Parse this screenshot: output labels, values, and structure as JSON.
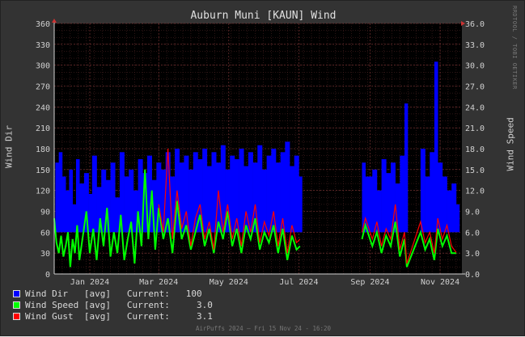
{
  "chart_data": {
    "type": "line",
    "title": "Auburn Muni [KAUN] Wind",
    "ylabel_left": "Wind Dir",
    "ylabel_right": "Wind Speed",
    "y_left_lim": [
      0,
      360
    ],
    "y_left_ticks": [
      "0",
      "30",
      "60",
      "90",
      "120",
      "150",
      "180",
      "210",
      "240",
      "270",
      "300",
      "330",
      "360"
    ],
    "y_right_lim": [
      0,
      36
    ],
    "y_right_ticks": [
      "0.0",
      "3.0",
      "6.0",
      "9.0",
      "12.0",
      "15.0",
      "18.0",
      "21.0",
      "24.0",
      "27.0",
      "30.0",
      "33.0",
      "36.0"
    ],
    "x_range": [
      "2023-12-01",
      "2024-11-20"
    ],
    "x_ticks": [
      {
        "label": "Jan 2024",
        "date": "2024-01-01"
      },
      {
        "label": "Mar 2024",
        "date": "2024-03-01"
      },
      {
        "label": "May 2024",
        "date": "2024-05-01"
      },
      {
        "label": "Jul 2024",
        "date": "2024-07-01"
      },
      {
        "label": "Sep 2024",
        "date": "2024-09-01"
      },
      {
        "label": "Nov 2024",
        "date": "2024-11-01"
      }
    ],
    "grid": true,
    "legend_position": "bottom-left",
    "series": [
      {
        "name": "Wind Dir",
        "stat": "[avg]",
        "current_label": "Current:",
        "current": "100",
        "color": "#0000ff",
        "axis": "left",
        "style": "bar",
        "points": [
          [
            "2023-12-02",
            160
          ],
          [
            "2023-12-05",
            175
          ],
          [
            "2023-12-08",
            140
          ],
          [
            "2023-12-11",
            120
          ],
          [
            "2023-12-14",
            150
          ],
          [
            "2023-12-17",
            100
          ],
          [
            "2023-12-20",
            165
          ],
          [
            "2023-12-23",
            130
          ],
          [
            "2023-12-27",
            145
          ],
          [
            "2023-12-31",
            115
          ],
          [
            "2024-01-03",
            170
          ],
          [
            "2024-01-07",
            125
          ],
          [
            "2024-01-11",
            150
          ],
          [
            "2024-01-15",
            135
          ],
          [
            "2024-01-19",
            160
          ],
          [
            "2024-01-23",
            110
          ],
          [
            "2024-01-27",
            175
          ],
          [
            "2024-01-31",
            140
          ],
          [
            "2024-02-04",
            150
          ],
          [
            "2024-02-08",
            120
          ],
          [
            "2024-02-12",
            165
          ],
          [
            "2024-02-16",
            145
          ],
          [
            "2024-02-20",
            170
          ],
          [
            "2024-02-24",
            135
          ],
          [
            "2024-02-28",
            160
          ],
          [
            "2024-03-03",
            150
          ],
          [
            "2024-03-07",
            175
          ],
          [
            "2024-03-11",
            140
          ],
          [
            "2024-03-15",
            180
          ],
          [
            "2024-03-19",
            160
          ],
          [
            "2024-03-23",
            170
          ],
          [
            "2024-03-27",
            150
          ],
          [
            "2024-03-31",
            175
          ],
          [
            "2024-04-04",
            165
          ],
          [
            "2024-04-08",
            180
          ],
          [
            "2024-04-12",
            155
          ],
          [
            "2024-04-16",
            175
          ],
          [
            "2024-04-20",
            160
          ],
          [
            "2024-04-24",
            185
          ],
          [
            "2024-04-28",
            150
          ],
          [
            "2024-05-02",
            170
          ],
          [
            "2024-05-06",
            165
          ],
          [
            "2024-05-10",
            180
          ],
          [
            "2024-05-14",
            155
          ],
          [
            "2024-05-18",
            175
          ],
          [
            "2024-05-22",
            160
          ],
          [
            "2024-05-26",
            185
          ],
          [
            "2024-05-30",
            150
          ],
          [
            "2024-06-03",
            170
          ],
          [
            "2024-06-07",
            180
          ],
          [
            "2024-06-11",
            160
          ],
          [
            "2024-06-15",
            175
          ],
          [
            "2024-06-19",
            190
          ],
          [
            "2024-06-23",
            155
          ],
          [
            "2024-06-27",
            170
          ],
          [
            "2024-07-01",
            140
          ],
          [
            "2024-08-25",
            160
          ],
          [
            "2024-08-28",
            140
          ],
          [
            "2024-09-03",
            150
          ],
          [
            "2024-09-07",
            120
          ],
          [
            "2024-09-11",
            165
          ],
          [
            "2024-09-15",
            145
          ],
          [
            "2024-09-19",
            160
          ],
          [
            "2024-09-23",
            130
          ],
          [
            "2024-09-27",
            170
          ],
          [
            "2024-10-01",
            245
          ],
          [
            "2024-10-15",
            180
          ],
          [
            "2024-10-19",
            140
          ],
          [
            "2024-10-23",
            175
          ],
          [
            "2024-10-27",
            305
          ],
          [
            "2024-10-30",
            160
          ],
          [
            "2024-11-03",
            140
          ],
          [
            "2024-11-07",
            120
          ],
          [
            "2024-11-11",
            130
          ],
          [
            "2024-11-15",
            100
          ]
        ]
      },
      {
        "name": "Wind Speed",
        "stat": "[avg]",
        "current_label": "Current:",
        "current": "3.0",
        "color": "#00ff00",
        "axis": "right",
        "style": "line",
        "points": [
          [
            "2023-12-01",
            8.0
          ],
          [
            "2023-12-03",
            4.5
          ],
          [
            "2023-12-05",
            3.0
          ],
          [
            "2023-12-07",
            5.5
          ],
          [
            "2023-12-09",
            2.5
          ],
          [
            "2023-12-11",
            4.0
          ],
          [
            "2023-12-13",
            6.0
          ],
          [
            "2023-12-15",
            1.0
          ],
          [
            "2023-12-17",
            5.0
          ],
          [
            "2023-12-19",
            3.0
          ],
          [
            "2023-12-21",
            7.0
          ],
          [
            "2023-12-23",
            2.0
          ],
          [
            "2023-12-26",
            5.5
          ],
          [
            "2023-12-29",
            9.0
          ],
          [
            "2024-01-01",
            3.0
          ],
          [
            "2024-01-04",
            6.5
          ],
          [
            "2024-01-07",
            2.0
          ],
          [
            "2024-01-10",
            8.0
          ],
          [
            "2024-01-13",
            4.0
          ],
          [
            "2024-01-16",
            9.5
          ],
          [
            "2024-01-19",
            2.5
          ],
          [
            "2024-01-22",
            6.0
          ],
          [
            "2024-01-25",
            3.0
          ],
          [
            "2024-01-28",
            8.5
          ],
          [
            "2024-01-31",
            2.0
          ],
          [
            "2024-02-03",
            5.0
          ],
          [
            "2024-02-06",
            7.5
          ],
          [
            "2024-02-09",
            1.5
          ],
          [
            "2024-02-12",
            9.0
          ],
          [
            "2024-02-15",
            4.0
          ],
          [
            "2024-02-18",
            15.0
          ],
          [
            "2024-02-21",
            5.0
          ],
          [
            "2024-02-24",
            12.0
          ],
          [
            "2024-02-27",
            3.5
          ],
          [
            "2024-03-01",
            9.5
          ],
          [
            "2024-03-05",
            5.0
          ],
          [
            "2024-03-09",
            8.0
          ],
          [
            "2024-03-13",
            3.0
          ],
          [
            "2024-03-17",
            10.5
          ],
          [
            "2024-03-21",
            5.0
          ],
          [
            "2024-03-25",
            7.0
          ],
          [
            "2024-03-29",
            3.5
          ],
          [
            "2024-04-02",
            6.0
          ],
          [
            "2024-04-06",
            8.5
          ],
          [
            "2024-04-10",
            4.0
          ],
          [
            "2024-04-14",
            6.5
          ],
          [
            "2024-04-18",
            3.0
          ],
          [
            "2024-04-22",
            7.5
          ],
          [
            "2024-04-26",
            5.0
          ],
          [
            "2024-04-30",
            9.0
          ],
          [
            "2024-05-04",
            4.0
          ],
          [
            "2024-05-08",
            6.5
          ],
          [
            "2024-05-12",
            3.0
          ],
          [
            "2024-05-16",
            7.0
          ],
          [
            "2024-05-20",
            5.0
          ],
          [
            "2024-05-24",
            8.0
          ],
          [
            "2024-05-28",
            3.5
          ],
          [
            "2024-06-01",
            6.0
          ],
          [
            "2024-06-05",
            4.5
          ],
          [
            "2024-06-09",
            7.0
          ],
          [
            "2024-06-13",
            3.0
          ],
          [
            "2024-06-17",
            6.5
          ],
          [
            "2024-06-21",
            2.0
          ],
          [
            "2024-06-25",
            5.5
          ],
          [
            "2024-06-29",
            3.5
          ],
          [
            "2024-07-02",
            4.0
          ],
          [
            "2024-08-25",
            5.0
          ],
          [
            "2024-08-28",
            7.0
          ],
          [
            "2024-09-03",
            4.0
          ],
          [
            "2024-09-07",
            6.0
          ],
          [
            "2024-09-11",
            3.0
          ],
          [
            "2024-09-15",
            5.5
          ],
          [
            "2024-09-19",
            4.0
          ],
          [
            "2024-09-23",
            7.5
          ],
          [
            "2024-09-27",
            2.5
          ],
          [
            "2024-10-01",
            5.0
          ],
          [
            "2024-10-03",
            1.0
          ],
          [
            "2024-10-15",
            6.0
          ],
          [
            "2024-10-19",
            3.5
          ],
          [
            "2024-10-23",
            5.0
          ],
          [
            "2024-10-27",
            2.0
          ],
          [
            "2024-10-30",
            6.5
          ],
          [
            "2024-11-03",
            4.0
          ],
          [
            "2024-11-07",
            5.5
          ],
          [
            "2024-11-11",
            3.0
          ],
          [
            "2024-11-15",
            3.0
          ]
        ]
      },
      {
        "name": "Wind Gust",
        "stat": "[avg]",
        "current_label": "Current:",
        "current": "3.1",
        "color": "#ff0000",
        "axis": "right",
        "style": "line",
        "points": [
          [
            "2024-03-01",
            10.0
          ],
          [
            "2024-03-05",
            6.0
          ],
          [
            "2024-03-09",
            18.0
          ],
          [
            "2024-03-13",
            5.0
          ],
          [
            "2024-03-17",
            12.0
          ],
          [
            "2024-03-21",
            6.5
          ],
          [
            "2024-03-25",
            9.0
          ],
          [
            "2024-03-29",
            4.0
          ],
          [
            "2024-04-02",
            8.0
          ],
          [
            "2024-04-06",
            10.0
          ],
          [
            "2024-04-10",
            5.0
          ],
          [
            "2024-04-14",
            7.5
          ],
          [
            "2024-04-18",
            3.5
          ],
          [
            "2024-04-22",
            12.0
          ],
          [
            "2024-04-26",
            6.0
          ],
          [
            "2024-04-30",
            10.0
          ],
          [
            "2024-05-04",
            5.0
          ],
          [
            "2024-05-08",
            8.0
          ],
          [
            "2024-05-12",
            4.0
          ],
          [
            "2024-05-16",
            9.0
          ],
          [
            "2024-05-20",
            6.0
          ],
          [
            "2024-05-24",
            10.0
          ],
          [
            "2024-05-28",
            4.5
          ],
          [
            "2024-06-01",
            7.5
          ],
          [
            "2024-06-05",
            5.5
          ],
          [
            "2024-06-09",
            9.0
          ],
          [
            "2024-06-13",
            4.0
          ],
          [
            "2024-06-17",
            8.0
          ],
          [
            "2024-06-21",
            3.0
          ],
          [
            "2024-06-25",
            7.0
          ],
          [
            "2024-06-29",
            4.5
          ],
          [
            "2024-07-02",
            5.0
          ],
          [
            "2024-08-25",
            6.0
          ],
          [
            "2024-08-28",
            8.0
          ],
          [
            "2024-09-03",
            5.0
          ],
          [
            "2024-09-07",
            7.5
          ],
          [
            "2024-09-11",
            4.0
          ],
          [
            "2024-09-15",
            6.5
          ],
          [
            "2024-09-19",
            5.0
          ],
          [
            "2024-09-23",
            10.0
          ],
          [
            "2024-09-27",
            3.5
          ],
          [
            "2024-10-01",
            6.0
          ],
          [
            "2024-10-03",
            1.5
          ],
          [
            "2024-10-15",
            7.5
          ],
          [
            "2024-10-19",
            4.5
          ],
          [
            "2024-10-23",
            6.0
          ],
          [
            "2024-10-27",
            3.0
          ],
          [
            "2024-10-30",
            8.0
          ],
          [
            "2024-11-03",
            5.0
          ],
          [
            "2024-11-07",
            7.0
          ],
          [
            "2024-11-11",
            4.0
          ],
          [
            "2024-11-15",
            3.1
          ]
        ]
      }
    ]
  },
  "watermark": "RRDTOOL / TOBI OETIKER",
  "footer": "AirPuffs 2024 — Fri 15 Nov 24 - 16:20"
}
